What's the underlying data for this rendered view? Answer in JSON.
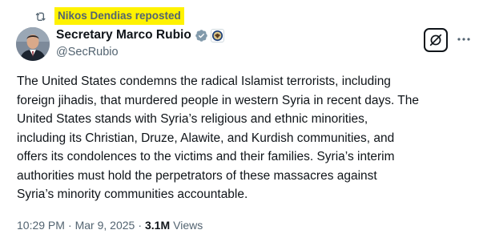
{
  "repost": {
    "icon": "repost-icon",
    "text": "Nikos Dendias reposted"
  },
  "author": {
    "name": "Secretary Marco Rubio",
    "handle": "@SecRubio",
    "verified_icon": "verified-badge-icon",
    "affiliation_icon": "government-seal-icon",
    "verified_color": "#829aab"
  },
  "actions": {
    "grok_icon": "grok-icon",
    "more_icon": "more-options-icon"
  },
  "tweet": {
    "text": "The United States condemns the radical Islamist terrorists, including\nforeign jihadis, that murdered people in western Syria in recent days. The\nUnited States stands with Syria’s religious and ethnic minorities,\nincluding its Christian, Druze, Alawite, and Kurdish communities, and\noffers its condolences to the victims and their families. Syria’s interim\nauthorities must hold the perpetrators of these massacres against\nSyria’s minority communities accountable."
  },
  "meta": {
    "time": "10:29 PM",
    "separator1": "·",
    "date": "Mar 9, 2025",
    "separator2": "·",
    "views_count": "3.1M",
    "views_label": "Views"
  },
  "colors": {
    "highlight": "#fff200",
    "text_primary": "#0f1419",
    "text_secondary": "#536471"
  }
}
